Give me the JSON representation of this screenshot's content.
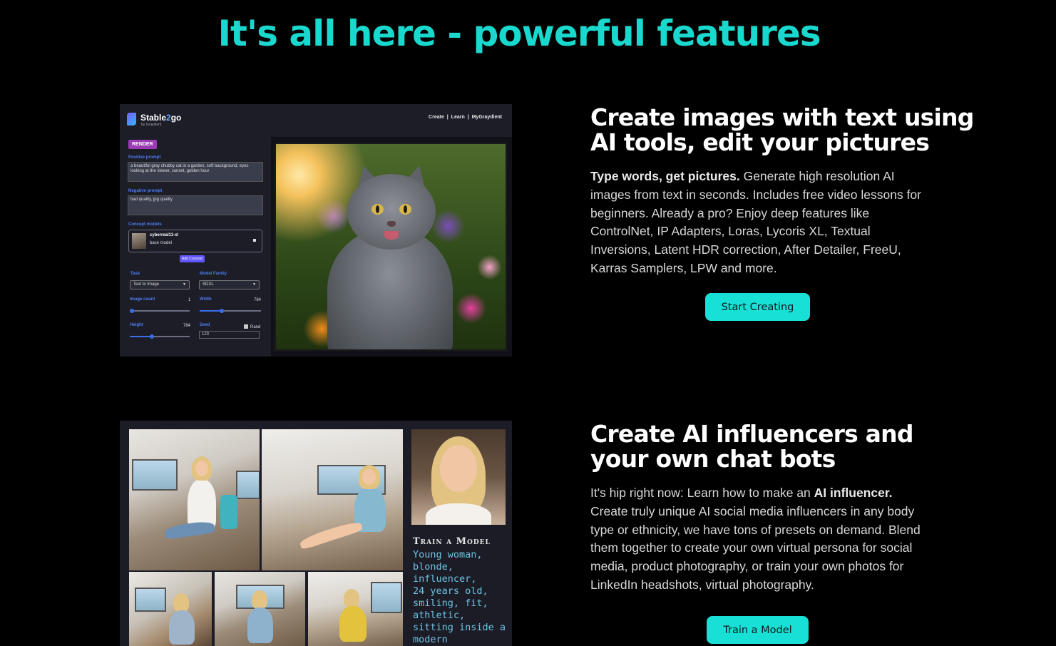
{
  "page": {
    "title": "It's all here - powerful features",
    "accent": "#19d9cf"
  },
  "features": [
    {
      "title_line1": "Create images with text using",
      "title_line2": "AI tools, edit your pictures",
      "body_strong": "Type words, get pictures.",
      "body_text": " Generate high resolution AI images from text in seconds. Includes free video lessons for beginners. Already a pro? Enjoy deep features like ControlNet, IP Adapters, Loras, Lycoris XL, Textual Inversions, Latent HDR correction, After Detailer, FreeU, Karras Samplers, LPW and more.",
      "button": "Start Creating"
    },
    {
      "title_line1": "Create AI influencers and",
      "title_line2": "your own chat bots",
      "body_pre": "It's hip right now: Learn how to make an ",
      "body_strong": "AI influencer.",
      "body_text": " Create truly unique AI social media influencers in any body type or ethnicity, we have tons of presets on demand. Blend them together to create your own virtual persona for social media, product photography, or train your own photos for LinkedIn headshots, virtual photography.",
      "button": "Train a Model"
    }
  ],
  "app_screenshot": {
    "brand_a": "Stable",
    "brand_b": "2",
    "brand_c": "go",
    "by": "by Graydient",
    "nav": "Create  |  Learn  |  MyGraydient",
    "render": "RENDER",
    "positive_label": "Positive prompt",
    "positive_value": "a beautiful gray chubby cat in a garden, soft background, eyes looking at the viewer, sunset, golden hour",
    "negative_label": "Negative prompt",
    "negative_value": "bad quality, jpg quality",
    "concept_label": "Concept models",
    "concept_name": "cyberreal11-xl",
    "concept_sub": "base model",
    "add_concept": "Add Concept",
    "task_label": "Task",
    "task_value": "Text to Image",
    "family_label": "Model Family",
    "family_value": "SDXL",
    "count_label": "Image count",
    "count_value": "1",
    "width_label": "Width",
    "width_value": "784",
    "height_label": "Height",
    "height_value": "784",
    "seed_label": "Seed",
    "seed_value": "123",
    "rand_label": "Rand"
  },
  "collage": {
    "title": "Train a Model",
    "lines": [
      "Young woman,",
      "blonde,",
      "influencer,",
      "24 years old,",
      "smiling, fit,",
      "athletic,",
      "sitting inside a",
      "modern"
    ]
  }
}
